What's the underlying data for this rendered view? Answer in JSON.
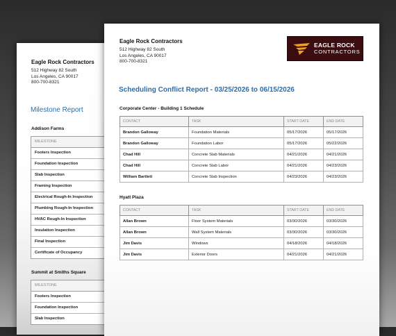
{
  "back_report": {
    "company": "Eagle Rock Contractors",
    "address1": "512 Highway 82 South",
    "address2": "Los Angeles, CA 90017",
    "phone": "800-700-8321",
    "title": "Milestone Report",
    "sections": [
      {
        "name": "Addison Farms",
        "header": "MILESTONE",
        "items": [
          "Footers Inspection",
          "Foundation Inspection",
          "Slab Inspection",
          "Framing Inspection",
          "Electrical Rough-In Inspection",
          "Plumbing Rough-In Inspection",
          "HVAC Rough-In Inspection",
          "Insulation Inspection",
          "Final Inspection",
          "Certificate of Occupancy"
        ]
      },
      {
        "name": "Summit at Smiths Square",
        "header": "MILESTONE",
        "items": [
          "Footers Inspection",
          "Foundation Inspection",
          "Slab Inspection"
        ]
      }
    ]
  },
  "front_report": {
    "company": "Eagle Rock Contractors",
    "address1": "512 Highway 82 South",
    "address2": "Los Angeles, CA 90017",
    "phone": "800-700-8321",
    "logo": {
      "line1": "EAGLE ROCK",
      "line2": "CONTRACTORS",
      "bg_color": "#3b0d10",
      "accent_color": "#f0a020"
    },
    "title": "Scheduling Conflict Report - 03/25/2026 to 06/15/2026",
    "title_color": "#2a6ead",
    "columns": [
      "CONTACT",
      "TASK",
      "START DATE",
      "END DATE"
    ],
    "sections": [
      {
        "name": "Corporate Center - Building 1 Schedule",
        "rows": [
          {
            "contact": "Brandon Galloway",
            "task": "Foundation Materials",
            "start": "05/17/2026",
            "end": "05/17/2026"
          },
          {
            "contact": "Brandon Galloway",
            "task": "Foundation Labor",
            "start": "05/17/2026",
            "end": "05/22/2026"
          },
          {
            "contact": "Chad Hill",
            "task": "Concrete Slab Materials",
            "start": "04/21/2026",
            "end": "04/21/2026"
          },
          {
            "contact": "Chad Hill",
            "task": "Concrete Slab Labor",
            "start": "04/21/2026",
            "end": "04/23/2026"
          },
          {
            "contact": "William Bartlett",
            "task": "Concrete Slab Inspection",
            "start": "04/23/2026",
            "end": "04/23/2026"
          }
        ]
      },
      {
        "name": "Hyatt Plaza",
        "rows": [
          {
            "contact": "Allan Brown",
            "task": "Floor System Materials",
            "start": "03/30/2026",
            "end": "03/30/2026"
          },
          {
            "contact": "Allan Brown",
            "task": "Wall System Materials",
            "start": "03/30/2026",
            "end": "03/30/2026"
          },
          {
            "contact": "Jim Davis",
            "task": "Windows",
            "start": "04/18/2026",
            "end": "04/18/2026"
          },
          {
            "contact": "Jim Davis",
            "task": "Exterior Doors",
            "start": "04/21/2026",
            "end": "04/21/2026"
          }
        ]
      }
    ]
  }
}
